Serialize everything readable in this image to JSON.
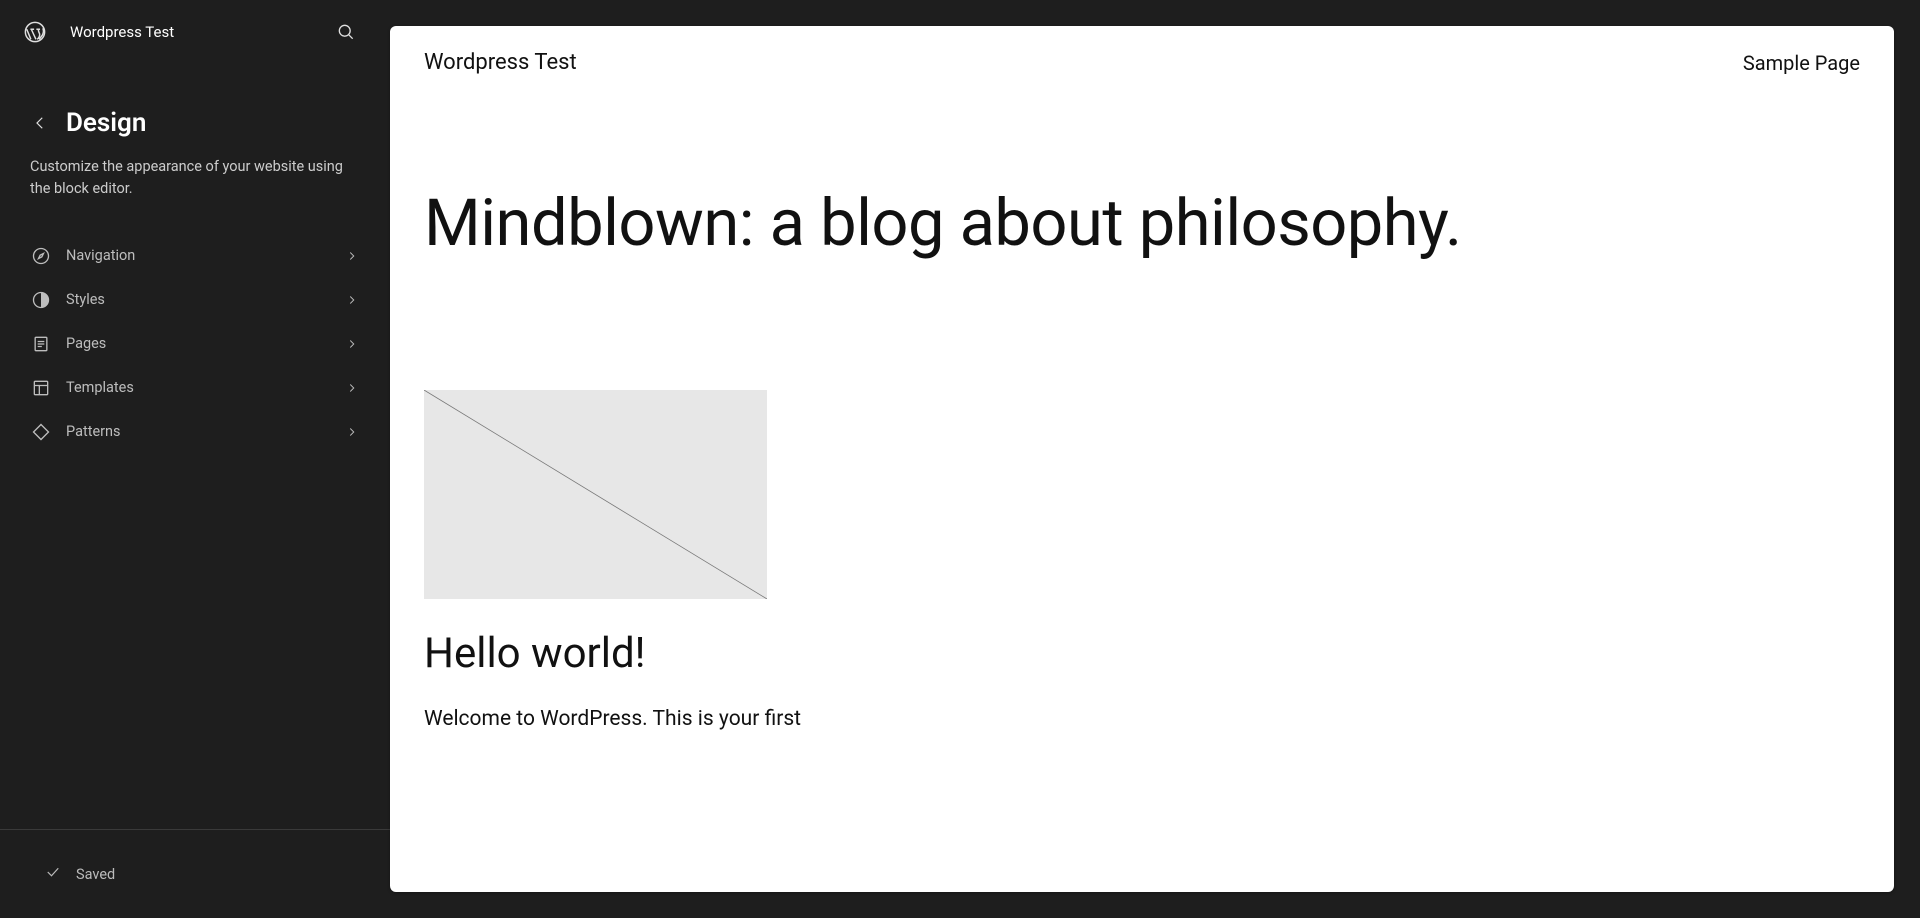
{
  "header": {
    "site_title": "Wordpress Test"
  },
  "panel": {
    "title": "Design",
    "description": "Customize the appearance of your website using the block editor."
  },
  "nav_items": [
    {
      "label": "Navigation",
      "icon": "compass-icon"
    },
    {
      "label": "Styles",
      "icon": "halfcircle-icon"
    },
    {
      "label": "Pages",
      "icon": "page-icon"
    },
    {
      "label": "Templates",
      "icon": "layout-icon"
    },
    {
      "label": "Patterns",
      "icon": "diamond-icon"
    }
  ],
  "footer": {
    "saved_label": "Saved"
  },
  "preview": {
    "site_title": "Wordpress Test",
    "menu_item": "Sample Page",
    "hero": "Mindblown: a blog about philosophy.",
    "post_title": "Hello world!",
    "post_excerpt": "Welcome to WordPress. This is your first"
  }
}
